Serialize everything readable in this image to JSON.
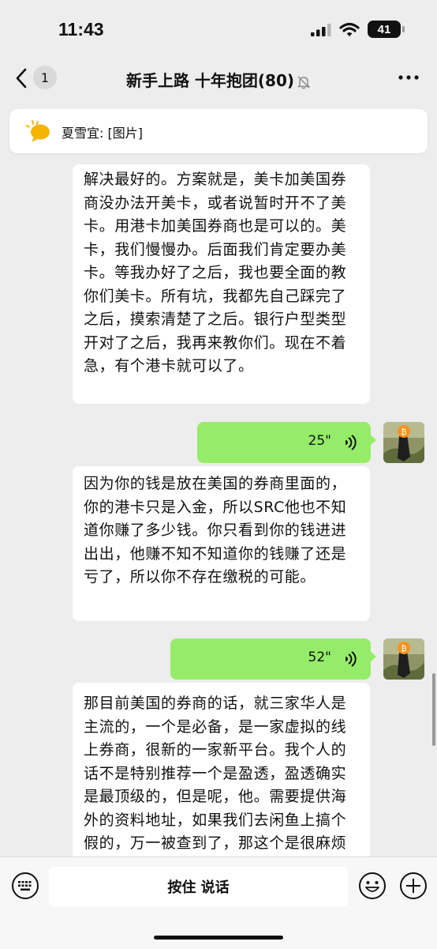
{
  "status": {
    "time": "11:43",
    "battery": "41"
  },
  "header": {
    "back_count": "1",
    "title": "新手上路 十年抱团(80)"
  },
  "pinned": {
    "text": "夏雪宜: [图片]"
  },
  "messages": {
    "m1": "解决最好的。方案就是，美卡加美国券商没办法开美卡，或者说暂时开不了美卡。用港卡加美国券商也是可以的。美卡，我们慢慢办。后面我们肯定要办美卡。等我办好了之后，我也要全面的教你们美卡。所有坑，我都先自己踩完了之后，摸索清楚了之后。银行户型类型开对了之后，我再来教你们。现在不着急，有个港卡就可以了。",
    "v1": "25\"",
    "m2": "因为你的钱是放在美国的券商里面的，你的港卡只是入金，所以SRC他也不知道你赚了多少钱。你只看到你的钱进进出出，他赚不知不知道你的钱赚了还是亏了，所以你不存在缴税的可能。",
    "v2": "52\"",
    "m3": "那目前美国的券商的话，就三家华人是主流的，一个是必备，是一家虚拟的线上券商，很新的一家新平台。我个人的话不是特别推荐一个是盈透，盈透确实是最顶级的，但是呢，他。需要提供海外的资料地址，如果我们去闲鱼上搞个假的，万一被查到了，那这个是很麻烦"
  },
  "input": {
    "talk_label": "按住 说话"
  },
  "colors": {
    "background": "#ededed",
    "outgoing_bubble": "#95ec69",
    "incoming_bubble": "#ffffff"
  }
}
